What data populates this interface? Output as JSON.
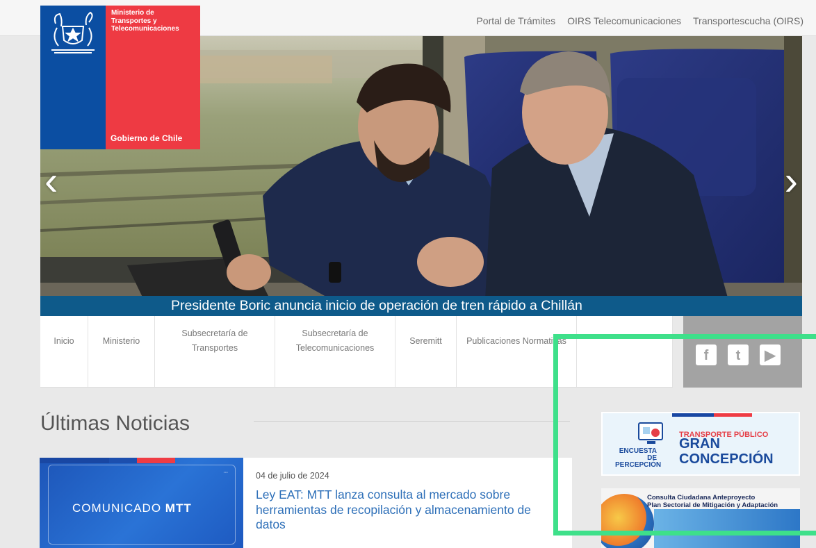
{
  "top_links": [
    "Portal de Trámites",
    "OIRS Telecomunicaciones",
    "Transportescucha (OIRS)"
  ],
  "logo": {
    "ministry_lines": [
      "Ministerio de",
      "Transportes y",
      "Telecomunicaciones"
    ],
    "government": "Gobierno de Chile"
  },
  "hero": {
    "caption": "Presidente Boric anuncia inicio de operación de tren rápido a Chillán",
    "prev_icon": "chevron-left-icon",
    "next_icon": "chevron-right-icon"
  },
  "nav": {
    "items": [
      {
        "label": "Inicio"
      },
      {
        "label": "Ministerio"
      },
      {
        "label": "Subsecretaría de Transportes"
      },
      {
        "label": "Subsecretaría de Telecomunicaciones"
      },
      {
        "label": "Seremitt"
      },
      {
        "label": "Publicaciones Normativas"
      },
      {
        "label": ""
      }
    ]
  },
  "social": {
    "icons": [
      "facebook-icon",
      "twitter-icon",
      "youtube-icon"
    ]
  },
  "news": {
    "section_title": "Últimas Noticias",
    "card_label_regular": "COMUNICADO",
    "card_label_bold": "MTT",
    "date": "04 de julio de 2024",
    "headline": "Ley EAT: MTT lanza consulta al mercado sobre herramientas de recopilación y almacenamiento de datos"
  },
  "banners": {
    "survey": {
      "encuesta": "ENCUESTA DE",
      "percepcion": "PERCEPCIÓN",
      "transporte": "TRANSPORTE PÚBLICO",
      "gran": "GRAN",
      "concepcion": "CONCEPCIÓN"
    },
    "consulta": {
      "line1": "Consulta Ciudadana Anteproyecto",
      "line2": "Plan Sectorial de Mitigación y Adaptación"
    }
  },
  "colors": {
    "gov_blue": "#0b4ea2",
    "gov_red": "#ee3a43",
    "caption_bar": "#0e5a8a",
    "link_blue": "#2d6fb8",
    "highlight_green": "#3ee08a"
  }
}
